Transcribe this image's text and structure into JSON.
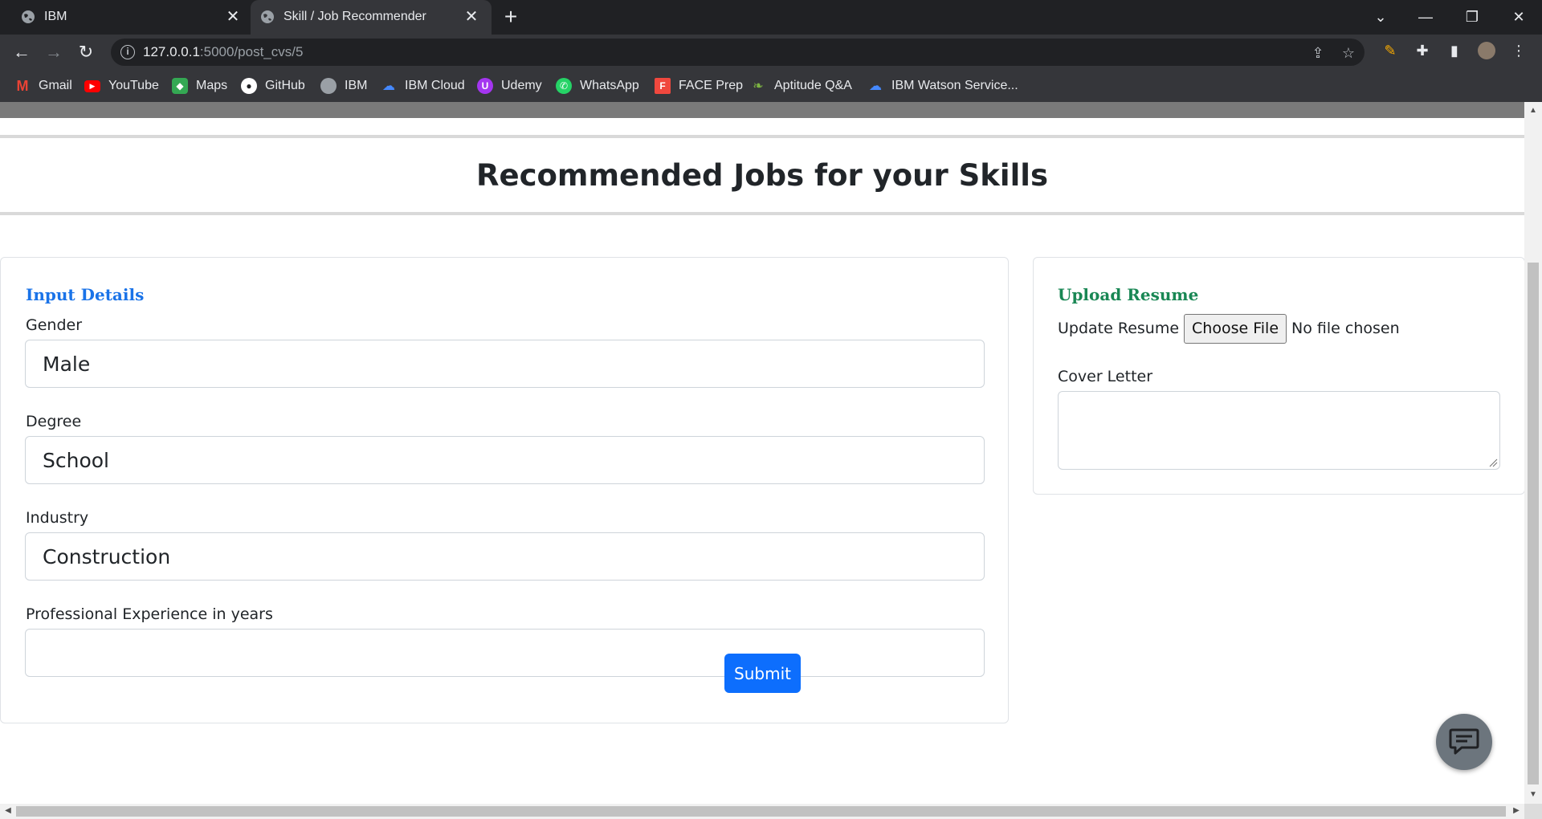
{
  "browser": {
    "tabs": [
      {
        "title": "IBM",
        "icon": "globe-icon",
        "active": false
      },
      {
        "title": "Skill / Job Recommender",
        "icon": "globe-icon",
        "active": true
      }
    ],
    "new_tab": "+",
    "url_host": "127.0.0.1",
    "url_path": ":5000/post_cvs/5",
    "bookmarks": [
      {
        "label": "Gmail",
        "icon": "gmail-icon",
        "color": "#ea4335"
      },
      {
        "label": "YouTube",
        "icon": "youtube-icon",
        "color": "#ff0000"
      },
      {
        "label": "Maps",
        "icon": "maps-icon",
        "color": "#34a853"
      },
      {
        "label": "GitHub",
        "icon": "github-icon",
        "color": "#ffffff"
      },
      {
        "label": "IBM",
        "icon": "globe-icon",
        "color": "#9aa0a6"
      },
      {
        "label": "IBM Cloud",
        "icon": "ibm-cloud-icon",
        "color": "#4589ff"
      },
      {
        "label": "Udemy",
        "icon": "udemy-icon",
        "color": "#a435f0"
      },
      {
        "label": "WhatsApp",
        "icon": "whatsapp-icon",
        "color": "#25d366"
      },
      {
        "label": "FACE Prep",
        "icon": "faceprep-icon",
        "color": "#f0483e"
      },
      {
        "label": "Aptitude Q&A",
        "icon": "leaf-icon",
        "color": "#7cb342"
      },
      {
        "label": "IBM Watson Service...",
        "icon": "ibm-cloud-icon",
        "color": "#4589ff"
      }
    ]
  },
  "page": {
    "title": "Recommended Jobs for your Skills",
    "input_details": {
      "heading": "Input Details",
      "gender_label": "Gender",
      "gender_value": "Male",
      "degree_label": "Degree",
      "degree_value": "School",
      "industry_label": "Industry",
      "industry_value": "Construction",
      "experience_label": "Professional Experience in years",
      "experience_value": ""
    },
    "upload_resume": {
      "heading": "Upload Resume",
      "update_label": "Update Resume",
      "choose_file": "Choose File",
      "file_status": "No file chosen",
      "cover_letter_label": "Cover Letter"
    },
    "submit_label": "Submit"
  },
  "colors": {
    "accent_blue": "#1a73e8",
    "accent_green": "#198754",
    "button_primary": "#0d6efd"
  }
}
